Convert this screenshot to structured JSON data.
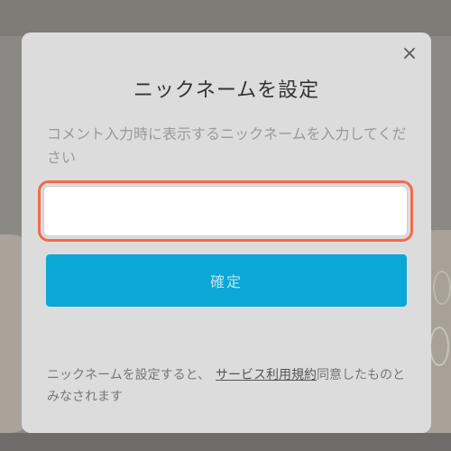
{
  "modal": {
    "close_label": "×",
    "title": "ニックネームを設定",
    "description": "コメント入力時に表示するニックネームを入力してください",
    "input": {
      "value": "",
      "placeholder": ""
    },
    "confirm_label": "確定",
    "footer": {
      "text_before": "ニックネームを設定すると、",
      "terms_link": "サービス利用規約",
      "text_after": "同意したものとみなされます"
    }
  },
  "colors": {
    "input_highlight": "#f26a4f",
    "confirm_button": "#0ba7d6",
    "modal_background": "#dcdcdc"
  }
}
